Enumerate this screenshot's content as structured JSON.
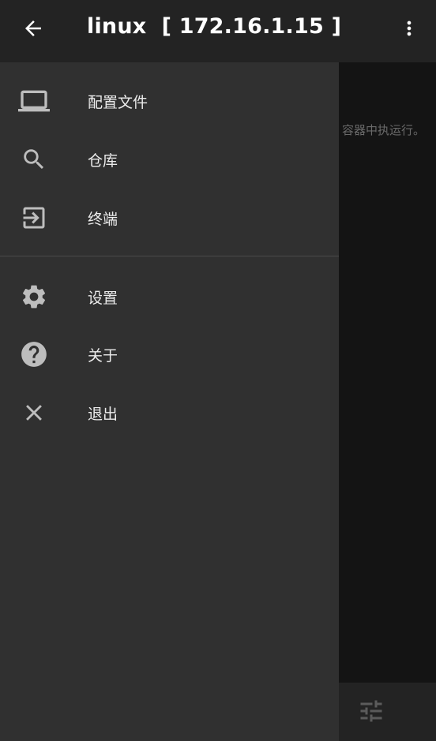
{
  "appbar": {
    "title": "linux  [ 172.16.1.15 ]",
    "back_icon": "arrow-back-icon",
    "menu_icon": "more-vert-icon"
  },
  "drawer": {
    "items": [
      {
        "label": "配置文件",
        "icon": "laptop-icon"
      },
      {
        "label": "仓库",
        "icon": "search-icon"
      },
      {
        "label": "终端",
        "icon": "exit-to-app-icon"
      },
      {
        "label": "设置",
        "icon": "gear-icon"
      },
      {
        "label": "关于",
        "icon": "help-circle-icon"
      },
      {
        "label": "退出",
        "icon": "close-icon"
      }
    ]
  },
  "background": {
    "partial_text": "容器中执运行。",
    "bottom_icon": "tune-icon"
  },
  "colors": {
    "appbar": "#232323",
    "drawer": "#303030",
    "text": "#ececec",
    "icon": "#bdbdbd",
    "background": "#141414"
  }
}
